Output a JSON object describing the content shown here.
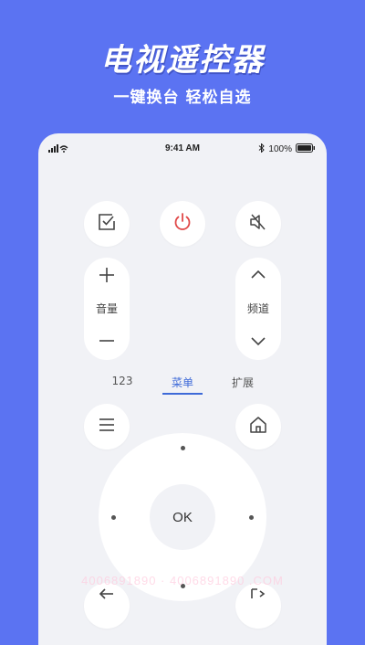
{
  "hero": {
    "title": "电视遥控器",
    "subtitle": "一键换台 轻松自选"
  },
  "status_bar": {
    "time": "9:41 AM",
    "battery": "100%"
  },
  "controls": {
    "volume_label": "音量",
    "channel_label": "频道"
  },
  "tabs": [
    {
      "label": "123",
      "active": false
    },
    {
      "label": "菜单",
      "active": true
    },
    {
      "label": "扩展",
      "active": false
    }
  ],
  "dpad": {
    "ok_label": "OK"
  },
  "watermark": "4006891890 · 4006891890 .COM",
  "colors": {
    "background": "#5b73f2",
    "panel": "#f1f2f6",
    "power_red": "#e04848",
    "accent_blue": "#3e6ad8"
  }
}
